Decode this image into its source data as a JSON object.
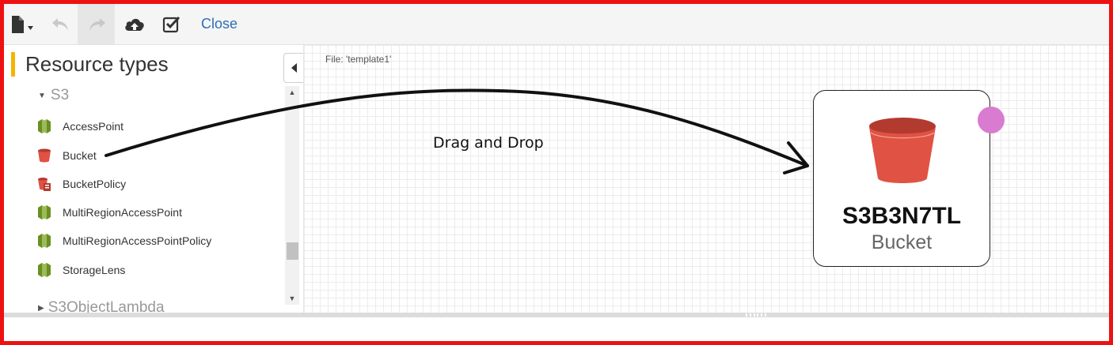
{
  "toolbar": {
    "new_icon": "file-icon",
    "undo_icon": "undo-icon",
    "redo_icon": "redo-icon",
    "upload_icon": "cloud-upload-icon",
    "validate_icon": "checkbox-icon",
    "close_label": "Close"
  },
  "sidebar": {
    "title": "Resource types",
    "group": "S3",
    "items": [
      {
        "label": "AccessPoint",
        "icon": "s3-accesspoint-icon"
      },
      {
        "label": "Bucket",
        "icon": "bucket-icon"
      },
      {
        "label": "BucketPolicy",
        "icon": "bucket-policy-icon"
      },
      {
        "label": "MultiRegionAccessPoint",
        "icon": "s3-accesspoint-icon"
      },
      {
        "label": "MultiRegionAccessPointPolicy",
        "icon": "s3-accesspoint-icon"
      },
      {
        "label": "StorageLens",
        "icon": "s3-accesspoint-icon"
      }
    ],
    "next_group": "S3ObjectLambda"
  },
  "canvas": {
    "file_label": "File: 'template1'",
    "annotation": "Drag and Drop",
    "node": {
      "id": "S3B3N7TL",
      "type": "Bucket"
    }
  },
  "colors": {
    "accent": "#f5b301",
    "bucket_red": "#e05243",
    "s3_green": "#6b8e23",
    "port": "#d97bd0",
    "frame": "#ee1111"
  }
}
